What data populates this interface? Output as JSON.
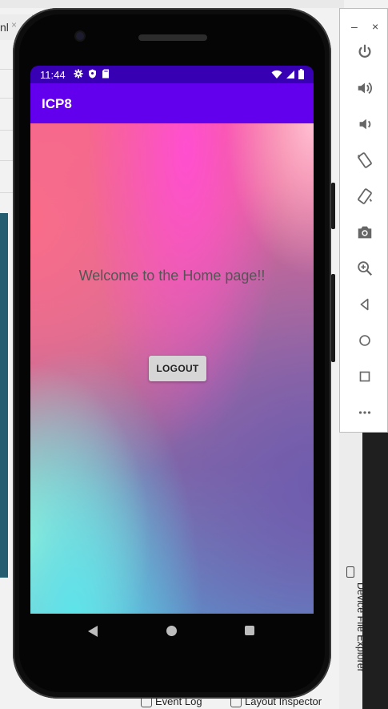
{
  "ide": {
    "tab_label": "nl",
    "tab_close": "×",
    "bottom_items": [
      "Event Log",
      "Layout Inspector"
    ],
    "side_panel_label": "Device File Explorer"
  },
  "emulator_toolbar": {
    "window_controls": [
      "–",
      "×"
    ],
    "buttons": [
      "power-icon",
      "volume-up-icon",
      "volume-down-icon",
      "rotate-left-icon",
      "rotate-right-icon",
      "camera-icon",
      "zoom-icon",
      "back-icon",
      "home-icon",
      "overview-icon",
      "more-icon"
    ]
  },
  "device": {
    "status": {
      "time": "11:44"
    },
    "appbar": {
      "title": "ICP8"
    },
    "content": {
      "welcome_text": "Welcome to the Home page!!",
      "logout_label": "LOGOUT"
    }
  },
  "colors": {
    "statusbar": "#3700b3",
    "appbar": "#6200ee"
  }
}
